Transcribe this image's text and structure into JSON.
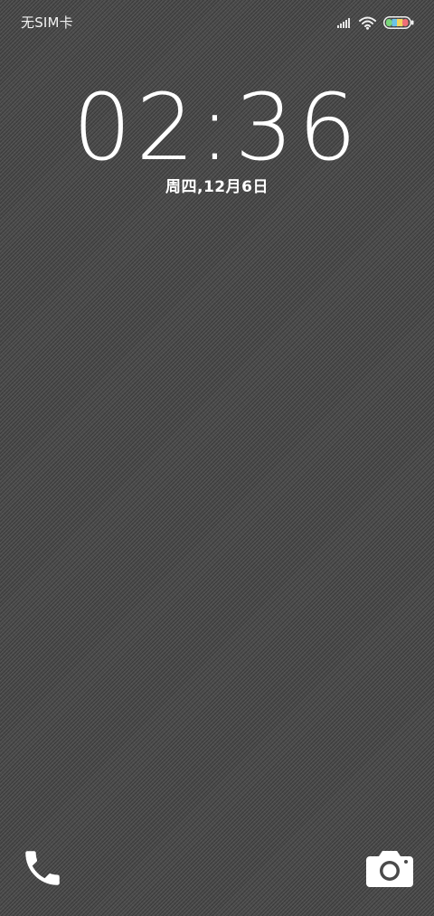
{
  "status_bar": {
    "carrier": "无SIM卡",
    "icons": [
      "signal-icon",
      "wifi-icon",
      "battery-icon"
    ],
    "battery_colors": [
      "#7ad67a",
      "#6ac3e8",
      "#f3d35c",
      "#ef6f78"
    ]
  },
  "lockscreen": {
    "time": "02:36",
    "date": "周四,12月6日"
  },
  "shortcuts": {
    "left": "phone-icon",
    "right": "camera-icon"
  },
  "colors": {
    "background": "#4a4a4a",
    "text": "#ffffff"
  }
}
